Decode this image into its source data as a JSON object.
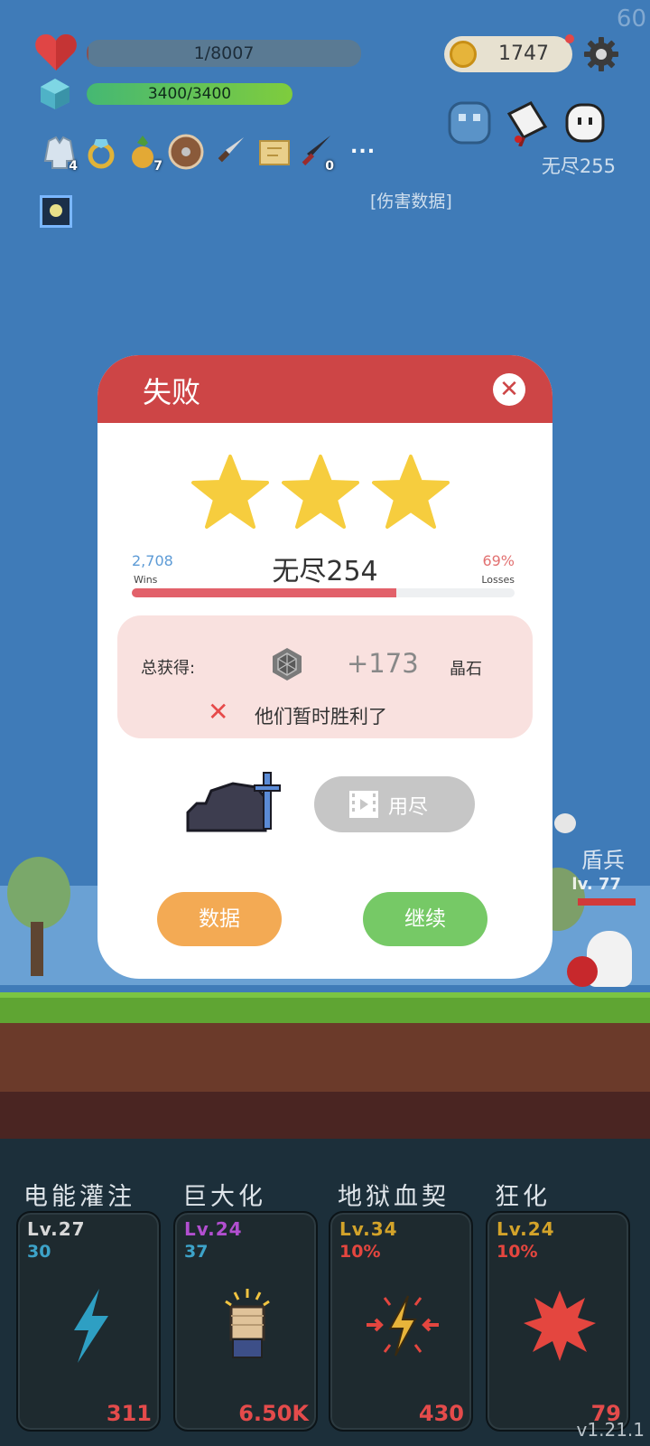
{
  "fps": "60",
  "hud": {
    "hp_text": "1/8007",
    "hp_ratio": 0.000125,
    "mp_text": "3400/3400",
    "mp_ratio": 1.0,
    "coins": "1747",
    "stage": "无尽255",
    "damage_link": "[伤害数据]",
    "more_items": "...",
    "items": [
      {
        "icon": "coat-icon",
        "count": "4"
      },
      {
        "icon": "ring-icon",
        "count": ""
      },
      {
        "icon": "pineapple-icon",
        "count": "7"
      },
      {
        "icon": "round-shield-icon",
        "count": ""
      },
      {
        "icon": "dagger-icon",
        "count": ""
      },
      {
        "icon": "map-scroll-icon",
        "count": ""
      },
      {
        "icon": "dark-sword-icon",
        "count": "0"
      }
    ]
  },
  "dialog": {
    "title": "失败",
    "stars": 3,
    "stage_name": "无尽254",
    "wins_value": "2,708",
    "wins_label": "Wins",
    "losses_value": "69%",
    "losses_label": "Losses",
    "loss_ratio": 0.69,
    "reward_label": "总获得:",
    "reward_amount": "+173",
    "reward_unit": "晶石",
    "result_message": "他们暂时胜利了",
    "ad_button_label": "用尽",
    "stats_button": "数据",
    "continue_button": "继续"
  },
  "enemy": {
    "name": "盾兵",
    "level": "lv. 77"
  },
  "skills": [
    {
      "name": "电能灌注",
      "level": "Lv.27",
      "sub": "30",
      "cost": "311",
      "level_color": "#d8d8d8",
      "sub_color": "#3da3c9",
      "icon": "lightning-icon"
    },
    {
      "name": "巨大化",
      "level": "Lv.24",
      "sub": "37",
      "cost": "6.50K",
      "level_color": "#b24fd0",
      "sub_color": "#3da3c9",
      "icon": "fist-icon"
    },
    {
      "name": "地狱血契",
      "level": "Lv.34",
      "sub": "10%",
      "cost": "430",
      "level_color": "#d3a32a",
      "sub_color": "#e4463f",
      "icon": "blood-pact-icon"
    },
    {
      "name": "狂化",
      "level": "Lv.24",
      "sub": "10%",
      "cost": "79",
      "level_color": "#d3a32a",
      "sub_color": "#e4463f",
      "icon": "berserk-icon"
    }
  ],
  "version": "v1.21.1"
}
